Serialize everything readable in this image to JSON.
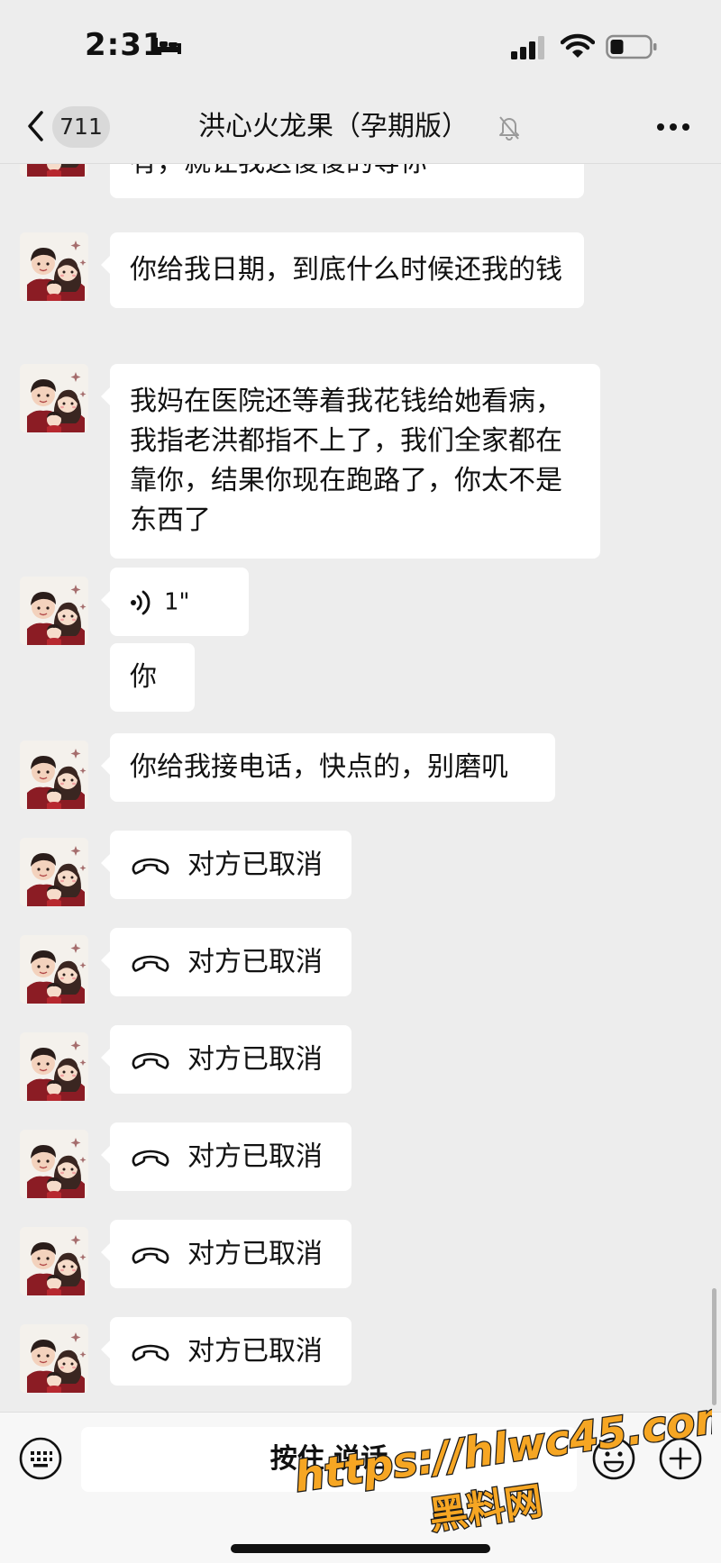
{
  "status_bar": {
    "time": "2:31"
  },
  "nav": {
    "unread_count": "711",
    "title": "洪心火龙果（孕期版）"
  },
  "messages": {
    "m0": {
      "text": "有，就让我这傻傻的等你"
    },
    "m1": {
      "text": "你给我日期，到底什么时候还我的钱"
    },
    "m2": {
      "text": "我妈在医院还等着我花钱给她看病，我指老洪都指不上了，我们全家都在靠你，结果你现在跑路了，你太不是东西了"
    },
    "m3": {
      "duration": "1\""
    },
    "m4": {
      "text": "你"
    },
    "m5": {
      "text": "你给我接电话，快点的，别磨叽"
    },
    "calls": [
      {
        "text": "对方已取消"
      },
      {
        "text": "对方已取消"
      },
      {
        "text": "对方已取消"
      },
      {
        "text": "对方已取消"
      },
      {
        "text": "对方已取消"
      },
      {
        "text": "对方已取消"
      }
    ]
  },
  "input_bar": {
    "hold_to_talk": "按住 说话"
  },
  "watermark": {
    "url": "https://hlwc45.com",
    "name": "黑料网"
  },
  "colors": {
    "background": "#ededed",
    "bubble": "#ffffff",
    "watermark_fill": "#f6a623",
    "watermark_stroke": "#1a1a1a"
  },
  "icons": [
    "bed-icon",
    "signal-icon",
    "wifi-icon",
    "battery-icon",
    "back-icon",
    "mute-icon",
    "more-icon",
    "voice-icon",
    "call-icon",
    "keyboard-icon",
    "emoji-icon",
    "plus-icon"
  ]
}
